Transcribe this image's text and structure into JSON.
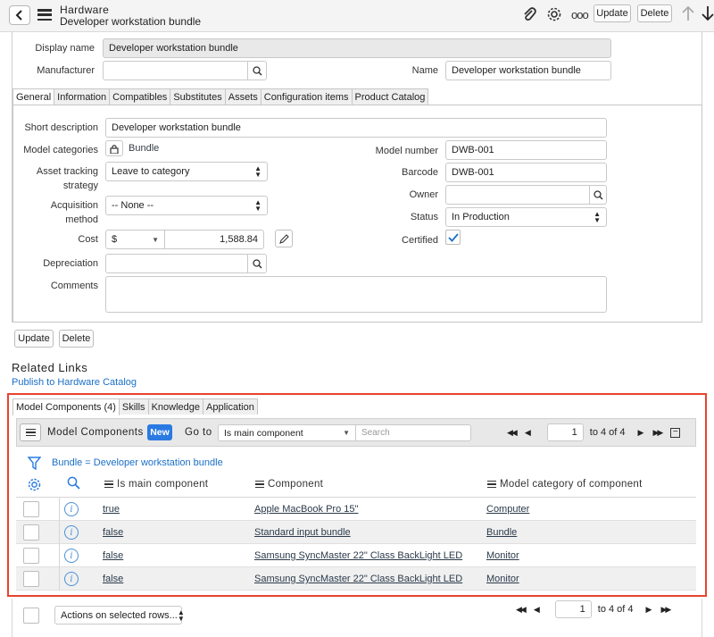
{
  "header": {
    "title": "Hardware",
    "subtitle": "Developer workstation bundle",
    "update_label": "Update",
    "delete_label": "Delete"
  },
  "record": {
    "display_name_label": "Display name",
    "display_name": "Developer workstation bundle",
    "manufacturer_label": "Manufacturer",
    "manufacturer": "",
    "name_label": "Name",
    "name": "Developer workstation bundle"
  },
  "form_tabs": [
    "General",
    "Information",
    "Compatibles",
    "Substitutes",
    "Assets",
    "Configuration items",
    "Product Catalog"
  ],
  "general": {
    "short_description_label": "Short description",
    "short_description": "Developer workstation bundle",
    "model_categories_label": "Model categories",
    "model_categories": "Bundle",
    "asset_tracking_label_1": "Asset tracking",
    "asset_tracking_label_2": "strategy",
    "asset_tracking": "Leave to category",
    "acquisition_label_1": "Acquisition",
    "acquisition_label_2": "method",
    "acquisition": "-- None --",
    "cost_label": "Cost",
    "cost_currency": "$",
    "cost_value": "1,588.84",
    "depreciation_label": "Depreciation",
    "depreciation": "",
    "comments_label": "Comments",
    "comments": "",
    "model_number_label": "Model number",
    "model_number": "DWB-001",
    "barcode_label": "Barcode",
    "barcode": "DWB-001",
    "owner_label": "Owner",
    "owner": "",
    "status_label": "Status",
    "status": "In Production",
    "certified_label": "Certified",
    "certified": true
  },
  "footer_buttons": {
    "update": "Update",
    "delete": "Delete"
  },
  "related_links": {
    "heading": "Related Links",
    "publish": "Publish to Hardware Catalog"
  },
  "related_tabs": [
    "Model Components (4)",
    "Skills",
    "Knowledge",
    "Application"
  ],
  "list": {
    "title": "Model Components",
    "new_label": "New",
    "goto_label": "Go to",
    "goto_field": "Is main component",
    "search_placeholder": "Search",
    "page_value": "1",
    "page_text": "to 4 of 4",
    "filter_text": "Bundle = Developer workstation bundle",
    "columns": [
      "Is main component",
      "Component",
      "Model category of component"
    ],
    "rows": [
      {
        "main": "true",
        "component": "Apple MacBook Pro 15\"",
        "category": "Computer"
      },
      {
        "main": "false",
        "component": "Standard input bundle",
        "category": "Bundle"
      },
      {
        "main": "false",
        "component": "Samsung SyncMaster 22\" Class BackLight LED",
        "category": "Monitor"
      },
      {
        "main": "false",
        "component": "Samsung SyncMaster 22\" Class BackLight LED",
        "category": "Monitor"
      }
    ],
    "actions_label": "Actions on selected rows...",
    "bottom_page_value": "1",
    "bottom_page_text": "to 4 of 4"
  },
  "colors": {
    "highlight": "#e8432e",
    "accent": "#1a6fc7",
    "new_button": "#2a7ae2"
  }
}
